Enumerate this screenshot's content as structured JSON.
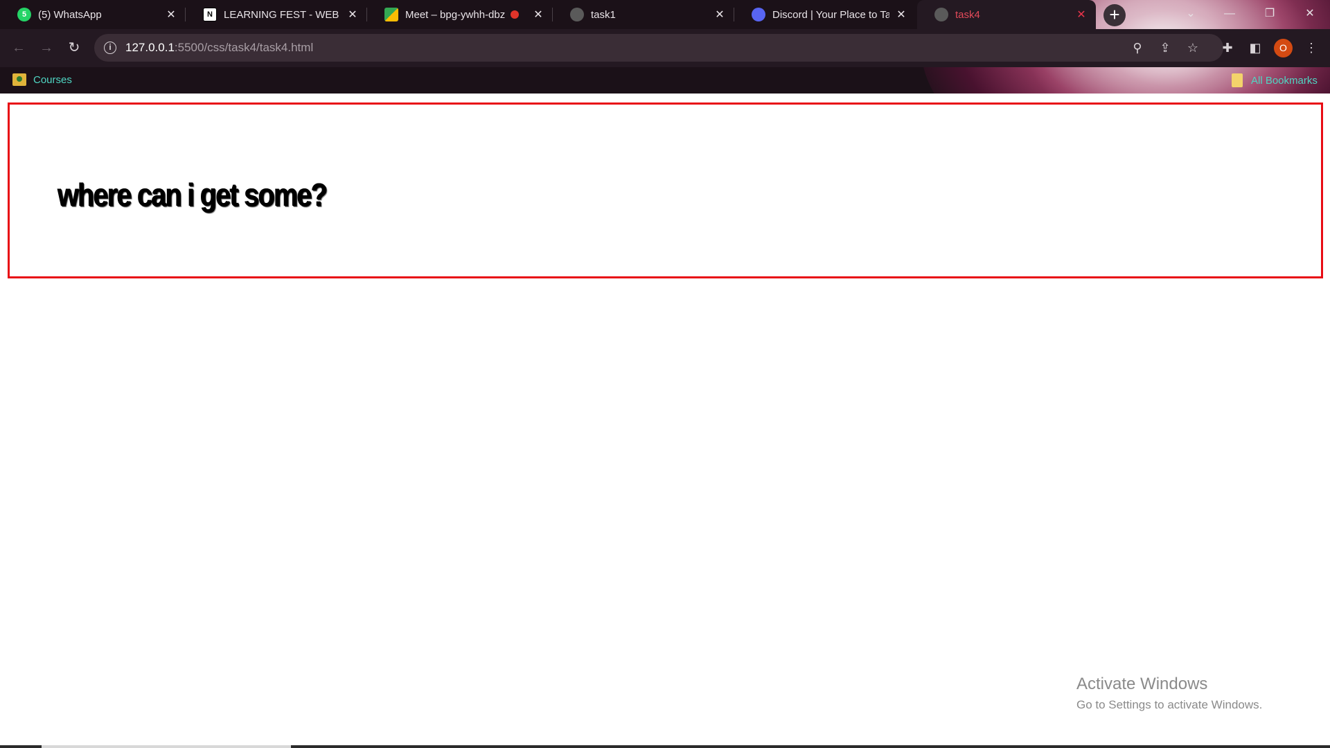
{
  "tabs": [
    {
      "title": "(5) WhatsApp",
      "icon": "whatsapp-icon",
      "color": "#25d366",
      "badge": "5"
    },
    {
      "title": "LEARNING FEST - WEB DE",
      "icon": "notion-icon",
      "color": "#ffffff",
      "badge": "N"
    },
    {
      "title": "Meet – bpg-ywhh-dbz",
      "icon": "google-meet-icon",
      "color": "#00897b",
      "badge": ""
    },
    {
      "title": "task1",
      "icon": "globe-icon",
      "color": "#5a5a5a",
      "badge": ""
    },
    {
      "title": "Discord | Your Place to Tal",
      "icon": "discord-icon",
      "color": "#5865f2",
      "badge": ""
    },
    {
      "title": "task4",
      "icon": "globe-icon",
      "color": "#5a5a5a",
      "badge": "",
      "active": true
    }
  ],
  "tab_close_glyph": "✕",
  "new_tab_glyph": "+",
  "window_controls": {
    "tab_search": "⌄",
    "minimize": "—",
    "restore": "❐",
    "close": "✕"
  },
  "toolbar": {
    "back": "←",
    "forward": "→",
    "reload": "↻",
    "url_host": "127.0.0.1",
    "url_rest": ":5500/css/task4/task4.html",
    "info_glyph": "i",
    "zoom_glyph": "⚲",
    "share_glyph": "⇪",
    "star_glyph": "☆",
    "extensions_glyph": "✚",
    "sidepanel_glyph": "◧",
    "menu_glyph": "⋮",
    "profile_initial": "O"
  },
  "bookmarks": {
    "courses": "Courses",
    "all_bookmarks": "All Bookmarks"
  },
  "page": {
    "heading": "where can i get some?",
    "border_color": "#e80c14"
  },
  "windows_watermark": {
    "title": "Activate Windows",
    "subtitle": "Go to Settings to activate Windows."
  },
  "colors": {
    "chrome_bg": "#1b1118",
    "toolbar_bg": "#241922",
    "bookmark_text": "#4fd6c3",
    "active_tab_text": "#e34a5a"
  }
}
